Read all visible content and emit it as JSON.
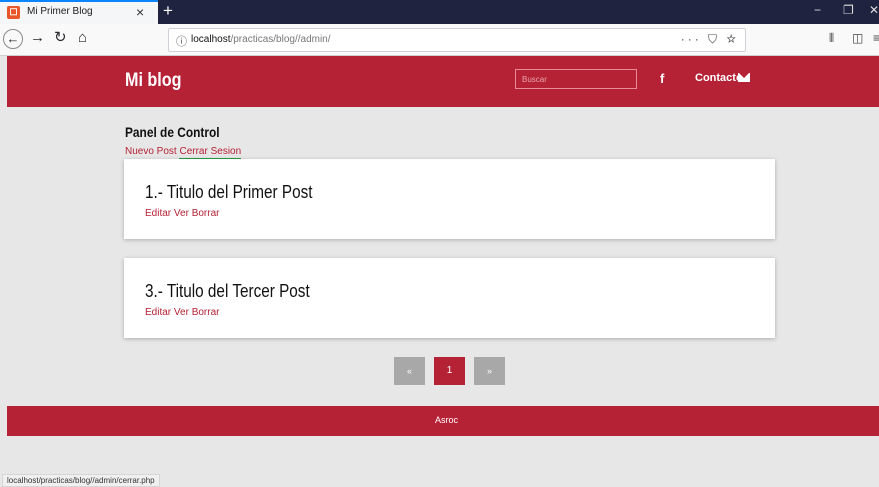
{
  "browser": {
    "tab_title": "Mi Primer Blog",
    "tab_favicon": "☐",
    "close_glyph": "×",
    "new_tab_glyph": "+",
    "url_host": "localhost",
    "url_path": "/practicas/blog//admin/",
    "url_actions": "··· ⛉ ☆",
    "status_url": "localhost/practicas/blog//admin/cerrar.php",
    "icons": [
      "back-icon",
      "forward-icon",
      "reload-icon",
      "home-icon",
      "info-icon",
      "library-icon",
      "sidebar-icon",
      "menu-icon"
    ]
  },
  "header": {
    "brand": "Mi blog",
    "search_placeholder": "Buscar",
    "facebook": "f",
    "contact": "Contacto",
    "color": "#b52135"
  },
  "panel": {
    "title": "Panel de Control",
    "new_post": "Nuevo Post",
    "logout": "Cerrar Sesion"
  },
  "posts": [
    {
      "title": "1.- Titulo del Primer Post",
      "edit": "Editar",
      "view": "Ver",
      "delete": "Borrar"
    },
    {
      "title": "3.- Titulo del Tercer Post",
      "edit": "Editar",
      "view": "Ver",
      "delete": "Borrar"
    }
  ],
  "pagination": {
    "prev": "«",
    "current": "1",
    "next": "»"
  },
  "footer": {
    "text": "Asroc"
  }
}
